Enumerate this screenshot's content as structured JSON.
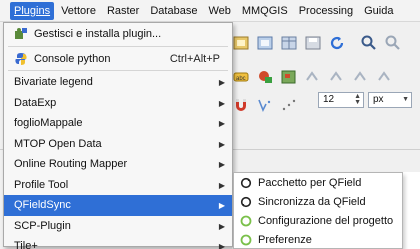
{
  "menubar": {
    "items": [
      "Plugins",
      "Vettore",
      "Raster",
      "Database",
      "Web",
      "MMQGIS",
      "Processing",
      "Guida"
    ]
  },
  "plugins_menu": {
    "manage": "Gestisci e installa plugin...",
    "console": "Console python",
    "console_shortcut": "Ctrl+Alt+P",
    "items": [
      "Bivariate legend",
      "DataExp",
      "foglioMappale",
      "MTOP Open Data",
      "Online Routing Mapper",
      "Profile Tool",
      "QFieldSync",
      "SCP-Plugin",
      "Tile+"
    ]
  },
  "qfieldsync_submenu": {
    "items": [
      "Pacchetto per QField",
      "Sincronizza da QField",
      "Configurazione del progetto",
      "Preferenze"
    ]
  },
  "toolbar": {
    "font_size_value": "12",
    "unit_value": "px"
  },
  "colors": {
    "highlight": "#2f6fd6",
    "menu_bg": "#f7f7f7"
  }
}
